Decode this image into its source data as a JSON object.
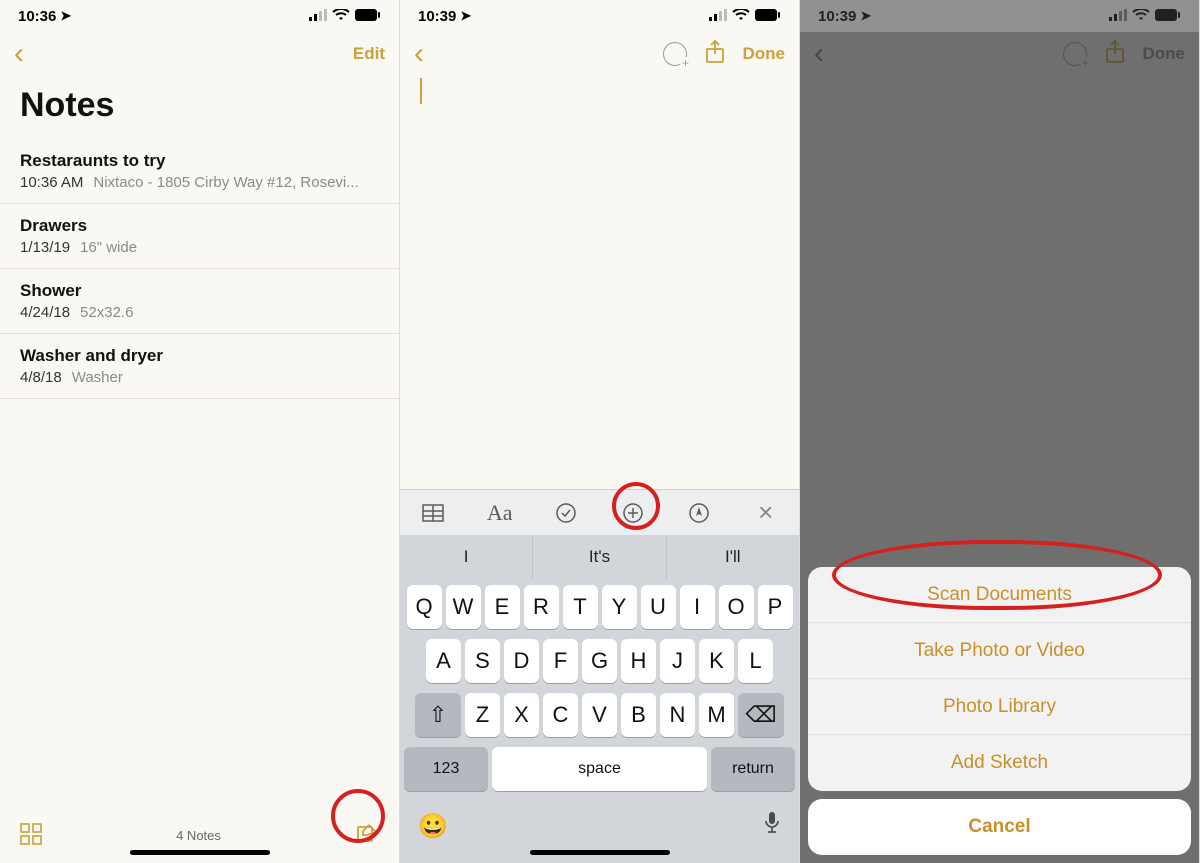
{
  "accent": "#c8a23c",
  "screen1": {
    "status": {
      "time": "10:36",
      "loc_arrow": "➤"
    },
    "nav": {
      "edit": "Edit"
    },
    "title": "Notes",
    "rows": [
      {
        "title": "Restaraunts to try",
        "date": "10:36 AM",
        "preview": "Nixtaco - 1805 Cirby Way #12, Rosevi..."
      },
      {
        "title": "Drawers",
        "date": "1/13/19",
        "preview": "16\" wide"
      },
      {
        "title": "Shower",
        "date": "4/24/18",
        "preview": "52x32.6"
      },
      {
        "title": "Washer and dryer",
        "date": "4/8/18",
        "preview": "Washer"
      }
    ],
    "footer_count": "4 Notes"
  },
  "screen2": {
    "status": {
      "time": "10:39",
      "loc_arrow": "➤"
    },
    "nav": {
      "done": "Done"
    },
    "kb_toolbar": {
      "table_icon": "table-icon",
      "format": "Aa",
      "check_icon": "check-circle-icon",
      "plus_icon": "plus-circle-icon",
      "markup_icon": "markup-icon",
      "close": "×"
    },
    "suggestions": [
      "I",
      "It's",
      "I'll"
    ],
    "rows": {
      "r1": [
        "Q",
        "W",
        "E",
        "R",
        "T",
        "Y",
        "U",
        "I",
        "O",
        "P"
      ],
      "r2": [
        "A",
        "S",
        "D",
        "F",
        "G",
        "H",
        "J",
        "K",
        "L"
      ],
      "r3_shift": "⇧",
      "r3": [
        "Z",
        "X",
        "C",
        "V",
        "B",
        "N",
        "M"
      ],
      "r3_del": "⌫",
      "num": "123",
      "space": "space",
      "return": "return"
    },
    "emoji": "😀",
    "mic": "🎤"
  },
  "screen3": {
    "status": {
      "time": "10:39",
      "loc_arrow": "➤"
    },
    "nav": {
      "done": "Done"
    },
    "sheet": {
      "opts": [
        "Scan Documents",
        "Take Photo or Video",
        "Photo Library",
        "Add Sketch"
      ],
      "cancel": "Cancel"
    }
  }
}
